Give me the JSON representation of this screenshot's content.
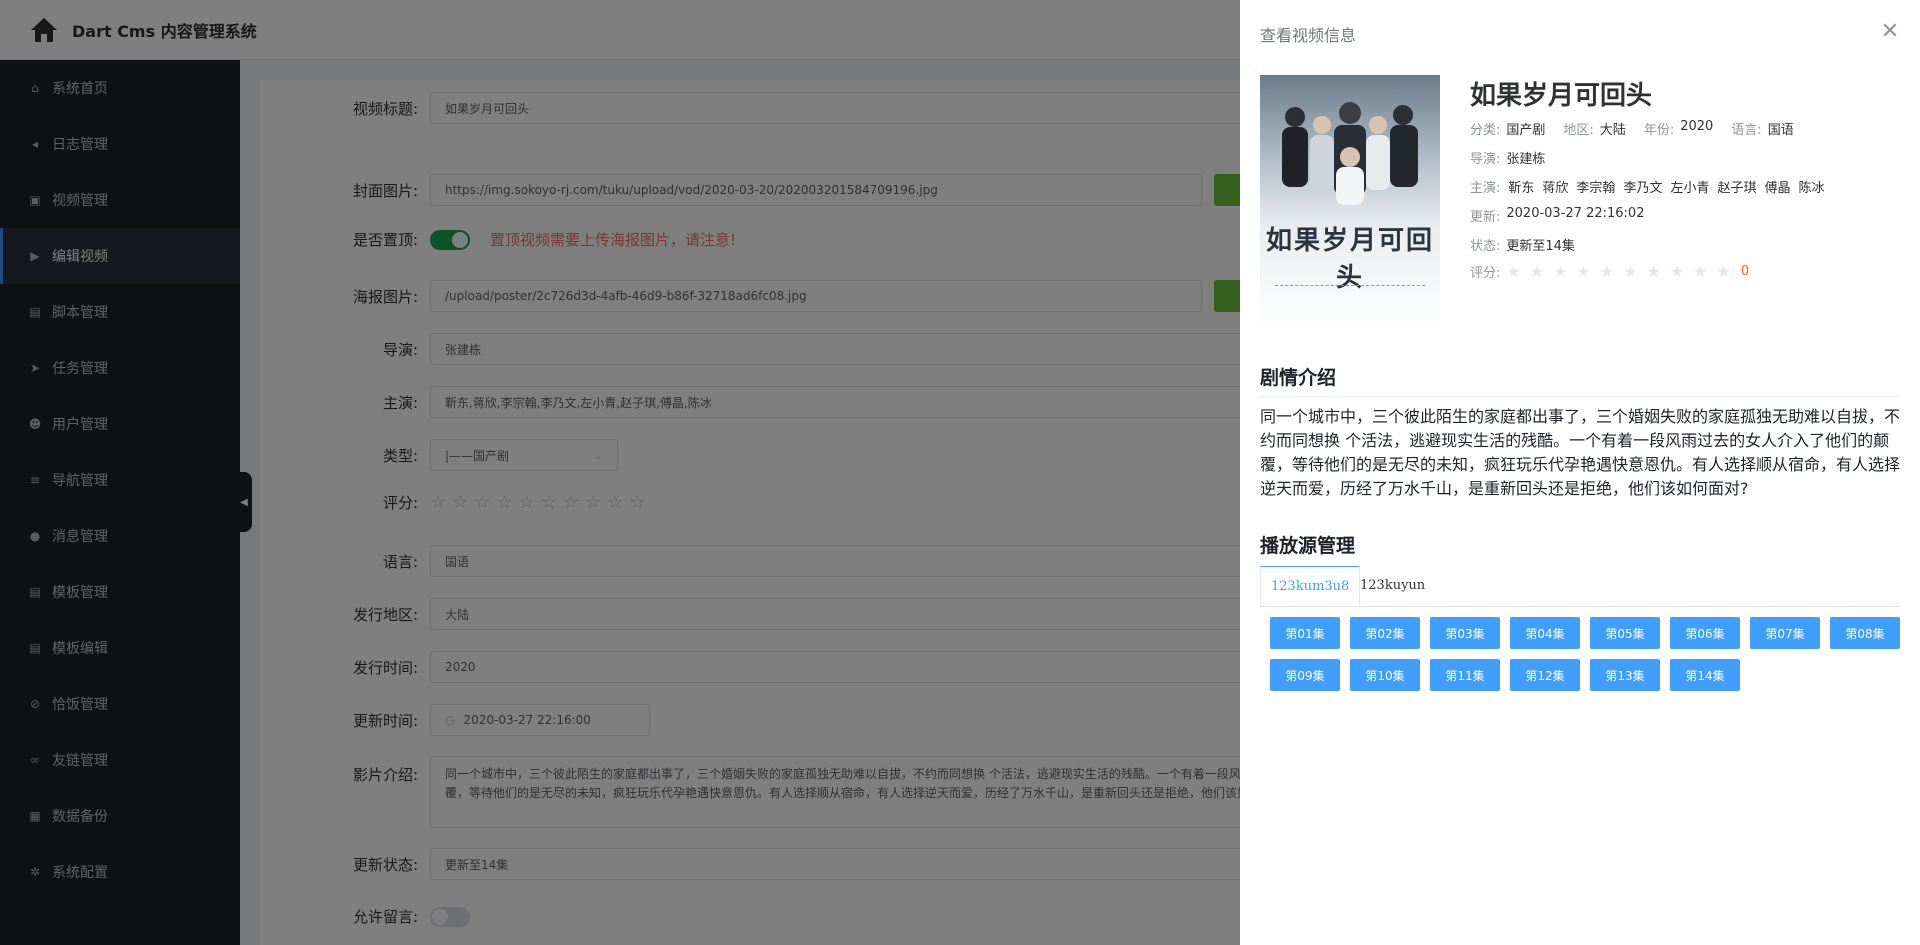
{
  "app": {
    "title": "Dart Cms 内容管理系统"
  },
  "sidebar": {
    "items": [
      {
        "label": "系统首页",
        "icon": "home-icon"
      },
      {
        "label": "日志管理",
        "icon": "megaphone-icon"
      },
      {
        "label": "视频管理",
        "icon": "video-icon"
      },
      {
        "label": "编辑视频",
        "icon": "youtube-icon"
      },
      {
        "label": "脚本管理",
        "icon": "file-icon"
      },
      {
        "label": "任务管理",
        "icon": "send-icon"
      },
      {
        "label": "用户管理",
        "icon": "user-add-icon"
      },
      {
        "label": "导航管理",
        "icon": "list-icon"
      },
      {
        "label": "消息管理",
        "icon": "chat-icon"
      },
      {
        "label": "模板管理",
        "icon": "file-icon"
      },
      {
        "label": "模板编辑",
        "icon": "file-icon"
      },
      {
        "label": "恰饭管理",
        "icon": "ban-icon"
      },
      {
        "label": "友链管理",
        "icon": "link-icon"
      },
      {
        "label": "数据备份",
        "icon": "database-icon"
      },
      {
        "label": "系统配置",
        "icon": "gear-icon"
      }
    ]
  },
  "form": {
    "title_label": "视频标题:",
    "title_value": "如果岁月可回头",
    "cover_label": "封面图片:",
    "cover_value": "https://img.sokoyo-rj.com/tuku/upload/vod/2020-03-20/202003201584709196.jpg",
    "top_label": "是否置顶:",
    "top_warning": "置顶视频需要上传海报图片，请注意!",
    "poster_label": "海报图片:",
    "poster_value": "/upload/poster/2c726d3d-4afb-46d9-b86f-32718ad6fc08.jpg",
    "director_label": "导演:",
    "director_value": "张建栋",
    "actors_label": "主演:",
    "actors_value": "靳东,蒋欣,李宗翰,李乃文,左小青,赵子琪,傅晶,陈冰",
    "type_label": "类型:",
    "type_value": "|——国产剧",
    "rating_label": "评分:",
    "language_label": "语言:",
    "language_value": "国语",
    "region_label": "发行地区:",
    "region_value": "大陆",
    "year_label": "发行时间:",
    "year_value": "2020",
    "update_time_label": "更新时间:",
    "update_time_value": "2020-03-27 22:16:00",
    "intro_label": "影片介绍:",
    "intro_value": "同一个城市中，三个彼此陌生的家庭都出事了，三个婚姻失败的家庭孤独无助难以自拔，不约而同想换 个活法，逃避现实生活的残酷。一个有着一段风雨过去的女人介入了他们的颠覆，等待他们的是无尽的未知，疯狂玩乐代孕艳遇快意恩仇。有人选择顺从宿命，有人选择逆天而爱，历经了万水千山，是重新回头还是拒绝，他们该如何面对?",
    "status_label": "更新状态:",
    "status_value": "更新至14集",
    "comment_label": "允许留言:"
  },
  "drawer": {
    "title": "查看视频信息",
    "video_title": "如果岁月可回头",
    "poster_text": "如果岁月可回头",
    "category_key": "分类:",
    "category": "国产剧",
    "region_key": "地区:",
    "region": "大陆",
    "year_key": "年份:",
    "year": "2020",
    "language_key": "语言:",
    "language": "国语",
    "director_key": "导演:",
    "director": "张建栋",
    "actors_key": "主演:",
    "actors": [
      "靳东",
      "蒋欣",
      "李宗翰",
      "李乃文",
      "左小青",
      "赵子琪",
      "傅晶",
      "陈冰"
    ],
    "update_key": "更新:",
    "update": "2020-03-27 22:16:02",
    "status_key": "状态:",
    "status": "更新至14集",
    "rating_key": "评分:",
    "rating": "0",
    "plot_title": "剧情介绍",
    "plot": "同一个城市中，三个彼此陌生的家庭都出事了，三个婚姻失败的家庭孤独无助难以自拔，不约而同想换 个活法，逃避现实生活的残酷。一个有着一段风雨过去的女人介入了他们的颠覆，等待他们的是无尽的未知，疯狂玩乐代孕艳遇快意恩仇。有人选择顺从宿命，有人选择逆天而爱，历经了万水千山，是重新回头还是拒绝，他们该如何面对?",
    "sources_title": "播放源管理",
    "tabs": [
      "123kum3u8",
      "123kuyun"
    ],
    "episodes": [
      "第01集",
      "第02集",
      "第03集",
      "第04集",
      "第05集",
      "第06集",
      "第07集",
      "第08集",
      "第09集",
      "第10集",
      "第11集",
      "第12集",
      "第13集",
      "第14集"
    ]
  }
}
